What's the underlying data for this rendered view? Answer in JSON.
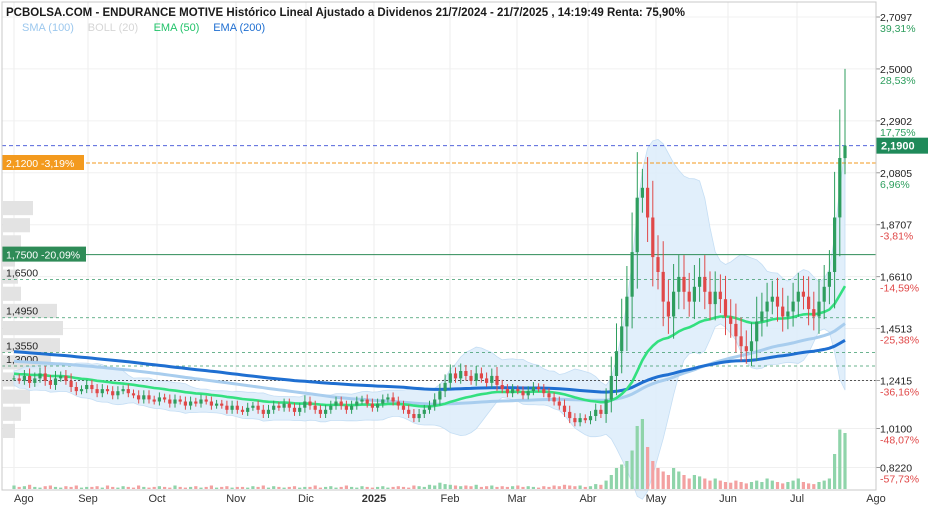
{
  "header": {
    "title": "PCBOLSA.COM - ENDURANCE MOTIVE Histórico Lineal Ajustado a Dividenos 21/7/2024 - 21/7/2025 , 14:19:49 Renta: 75,90%"
  },
  "legend": [
    {
      "label": "SMA (100)",
      "color": "#9cc8ee"
    },
    {
      "label": "BOLL (20)",
      "color": "#d6d6d6"
    },
    {
      "label": "EMA (50)",
      "color": "#22c36a"
    },
    {
      "label": "EMA (200)",
      "color": "#1f6fd1"
    }
  ],
  "colors": {
    "up": "#2e9e5e",
    "down": "#e04848",
    "ema50": "#33e07f",
    "ema200": "#1f6fd1",
    "sma100": "#a8cdee",
    "boll_fill": "#dcecfa",
    "orange": "#f39a1e",
    "green_level": "#2e8b57",
    "current": "#1f8a5a"
  },
  "chart_data": {
    "type": "candlestick",
    "title": "PCBOLSA.COM - ENDURANCE MOTIVE Histórico Lineal Ajustado a Dividenos 21/7/2024 - 21/7/2025 , 14:19:49 Renta: 75,90%",
    "x_range": [
      "2024-07-21",
      "2025-07-21"
    ],
    "x_ticks": [
      "Ago",
      "Sep",
      "Oct",
      "Nov",
      "Dic",
      "2025",
      "Feb",
      "Mar",
      "Abr",
      "May",
      "Jun",
      "Jul",
      "Ago"
    ],
    "y_ticks": [
      {
        "price": "2,7097",
        "pct": "39,31%"
      },
      {
        "price": "2,5000",
        "pct": "28,53%"
      },
      {
        "price": "2,2902",
        "pct": "17,75%"
      },
      {
        "price": "2,0805",
        "pct": "6,96%"
      },
      {
        "price": "1,8707",
        "pct": "-3,81%"
      },
      {
        "price": "1,6610",
        "pct": "-14,59%"
      },
      {
        "price": "1,4513",
        "pct": "-25,38%"
      },
      {
        "price": "1,2415",
        "pct": "-36,16%"
      },
      {
        "price": "1,0100",
        "pct": "-48,07%"
      },
      {
        "price": "0,8220",
        "pct": "-57,73%"
      }
    ],
    "current_price": "2,1900",
    "levels": [
      {
        "label": "2,1200 -3,19%",
        "value": 2.12,
        "style": "orange"
      },
      {
        "label": "1,7500 -20,09%",
        "value": 1.75,
        "style": "green"
      },
      {
        "label": "1,6500",
        "value": 1.65,
        "style": "dashed"
      },
      {
        "label": "1,4950",
        "value": 1.495,
        "style": "dashed"
      },
      {
        "label": "1,3550",
        "value": 1.355,
        "style": "dashed"
      },
      {
        "label": "1,3000",
        "value": 1.3,
        "style": "dashed"
      }
    ],
    "close": [
      1.25,
      1.24,
      1.26,
      1.23,
      1.25,
      1.27,
      1.24,
      1.22,
      1.25,
      1.26,
      1.24,
      1.21,
      1.19,
      1.2,
      1.22,
      1.2,
      1.18,
      1.2,
      1.19,
      1.17,
      1.19,
      1.2,
      1.18,
      1.17,
      1.15,
      1.17,
      1.15,
      1.14,
      1.16,
      1.15,
      1.13,
      1.15,
      1.14,
      1.12,
      1.14,
      1.13,
      1.15,
      1.14,
      1.12,
      1.13,
      1.12,
      1.1,
      1.12,
      1.1,
      1.09,
      1.11,
      1.12,
      1.1,
      1.08,
      1.1,
      1.12,
      1.11,
      1.13,
      1.11,
      1.09,
      1.11,
      1.14,
      1.12,
      1.1,
      1.08,
      1.1,
      1.12,
      1.14,
      1.12,
      1.1,
      1.12,
      1.14,
      1.15,
      1.13,
      1.11,
      1.13,
      1.15,
      1.16,
      1.14,
      1.12,
      1.1,
      1.08,
      1.06,
      1.08,
      1.1,
      1.12,
      1.15,
      1.19,
      1.23,
      1.27,
      1.25,
      1.28,
      1.26,
      1.24,
      1.27,
      1.25,
      1.23,
      1.26,
      1.22,
      1.2,
      1.18,
      1.2,
      1.19,
      1.17,
      1.19,
      1.21,
      1.2,
      1.18,
      1.16,
      1.14,
      1.12,
      1.09,
      1.06,
      1.04,
      1.06,
      1.05,
      1.07,
      1.1,
      1.08,
      1.15,
      1.26,
      1.36,
      1.46,
      1.58,
      1.76,
      1.98,
      2.02,
      1.9,
      1.74,
      1.68,
      1.56,
      1.5,
      1.6,
      1.66,
      1.6,
      1.56,
      1.62,
      1.66,
      1.6,
      1.55,
      1.6,
      1.57,
      1.5,
      1.47,
      1.42,
      1.38,
      1.36,
      1.4,
      1.48,
      1.52,
      1.56,
      1.58,
      1.54,
      1.5,
      1.52,
      1.56,
      1.6,
      1.58,
      1.53,
      1.5,
      1.56,
      1.62,
      1.68,
      1.9,
      2.14,
      2.19
    ],
    "volume": [
      0.05,
      0.03,
      0.04,
      0.06,
      0.03,
      0.02,
      0.04,
      0.05,
      0.03,
      0.02,
      0.04,
      0.03,
      0.05,
      0.02,
      0.03,
      0.03,
      0.04,
      0.02,
      0.05,
      0.03,
      0.02,
      0.04,
      0.03,
      0.02,
      0.05,
      0.03,
      0.02,
      0.03,
      0.04,
      0.03,
      0.02,
      0.05,
      0.03,
      0.02,
      0.03,
      0.04,
      0.02,
      0.03,
      0.05,
      0.02,
      0.03,
      0.04,
      0.02,
      0.03,
      0.03,
      0.02,
      0.04,
      0.03,
      0.05,
      0.02,
      0.04,
      0.03,
      0.02,
      0.03,
      0.04,
      0.02,
      0.03,
      0.03,
      0.05,
      0.02,
      0.03,
      0.04,
      0.02,
      0.03,
      0.05,
      0.03,
      0.02,
      0.04,
      0.03,
      0.02,
      0.03,
      0.04,
      0.02,
      0.03,
      0.04,
      0.03,
      0.02,
      0.05,
      0.04,
      0.03,
      0.06,
      0.05,
      0.09,
      0.07,
      0.06,
      0.05,
      0.04,
      0.05,
      0.04,
      0.06,
      0.03,
      0.04,
      0.05,
      0.03,
      0.04,
      0.03,
      0.04,
      0.05,
      0.03,
      0.04,
      0.03,
      0.02,
      0.04,
      0.03,
      0.05,
      0.04,
      0.06,
      0.05,
      0.04,
      0.05,
      0.03,
      0.04,
      0.07,
      0.06,
      0.12,
      0.2,
      0.3,
      0.35,
      0.4,
      0.55,
      0.9,
      1.0,
      0.6,
      0.4,
      0.3,
      0.25,
      0.2,
      0.3,
      0.25,
      0.2,
      0.15,
      0.2,
      0.18,
      0.15,
      0.12,
      0.15,
      0.12,
      0.1,
      0.09,
      0.12,
      0.1,
      0.08,
      0.1,
      0.12,
      0.1,
      0.15,
      0.12,
      0.1,
      0.08,
      0.1,
      0.12,
      0.15,
      0.1,
      0.08,
      0.07,
      0.1,
      0.12,
      0.15,
      0.5,
      0.85,
      0.8
    ],
    "volume_profile": [
      0.5,
      0.45,
      0.3,
      0.2,
      0.25,
      0.3,
      0.9,
      1.0,
      0.95,
      0.8,
      0.6,
      0.45,
      0.3,
      0.2
    ]
  }
}
